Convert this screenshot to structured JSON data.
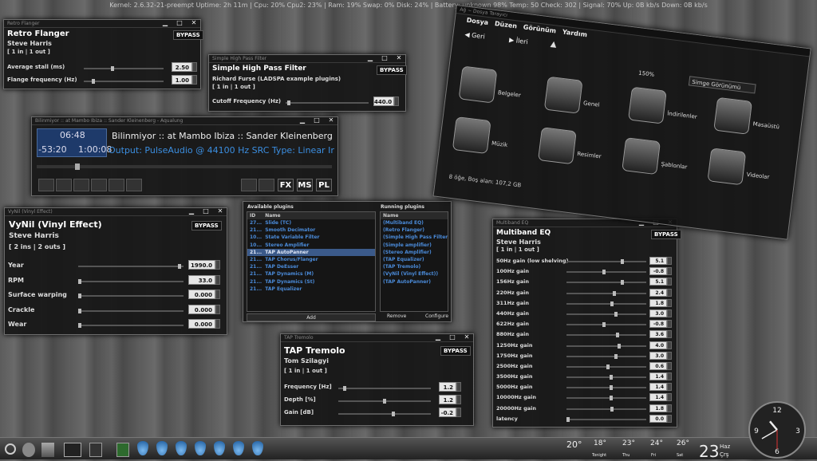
{
  "topbar": {
    "text": "Kernel: 2.6.32-21-preempt  Uptime: 2h 11m  |  Cpu: 20%  Cpu2: 23%  |  Ram: 19%  Swap: 0%  Disk: 24%  |  Battery: unknown  98%  Temp: 50  Check: 302  |  Signal: 70%  Up: 0B kb/s  Down: 0B kb/s"
  },
  "flanger": {
    "wintitle": "Retro Flanger",
    "title": "Retro Flanger",
    "author": "Steve Harris",
    "io": "[ 1 in | 1 out ]",
    "bypass": "BYPASS",
    "params": [
      {
        "label": "Average stall (ms)",
        "value": "2.50",
        "level": 0.35
      },
      {
        "label": "Flange frequency (Hz)",
        "value": "1.00",
        "level": 0.1
      }
    ]
  },
  "hpf": {
    "wintitle": "Simple High Pass Filter",
    "title": "Simple High Pass Filter",
    "author": "Richard Furse (LADSPA example plugins)",
    "io": "[ 1 in | 1 out ]",
    "bypass": "BYPASS",
    "params": [
      {
        "label": "Cutoff Frequency (Hz)",
        "value": "440.0",
        "level": 0.02
      }
    ]
  },
  "player": {
    "wintitle": "Bilinmiyor :: at Mambo Ibiza :: Sander Kleinenberg - Aqualung",
    "time1": "06:48",
    "time2": "-53:20",
    "time3": "1:00:08",
    "track": "Bilinmiyor :: at Mambo Ibiza :: Sander Kleinenberg",
    "output": "Output: PulseAudio @ 44100 Hz SRC Type: Linear Ir",
    "fx": "FX",
    "ms": "MS",
    "pl": "PL"
  },
  "vynil": {
    "wintitle": "VyNil (Vinyl Effect)",
    "title": "VyNil (Vinyl Effect)",
    "author": "Steve Harris",
    "io": "[ 2 ins | 2 outs ]",
    "bypass": "BYPASS",
    "params": [
      {
        "label": "Year",
        "value": "1990.0",
        "level": 0.98
      },
      {
        "label": "RPM",
        "value": "33.0",
        "level": 0.0
      },
      {
        "label": "Surface warping",
        "value": "0.000",
        "level": 0.0
      },
      {
        "label": "Crackle",
        "value": "0.000",
        "level": 0.0
      },
      {
        "label": "Wear",
        "value": "0.000",
        "level": 0.0
      }
    ]
  },
  "plugins": {
    "available_title": "Available plugins",
    "running_title": "Running plugins",
    "col_id": "ID",
    "col_name": "Name",
    "col_rname": "Name",
    "available": [
      {
        "id": "27...",
        "name": "Slide (TC)"
      },
      {
        "id": "21...",
        "name": "Smooth Decimator"
      },
      {
        "id": "10...",
        "name": "State Variable Filter"
      },
      {
        "id": "10...",
        "name": "Stereo Amplifier"
      },
      {
        "id": "21...",
        "name": "TAP AutoPanner"
      },
      {
        "id": "21...",
        "name": "TAP Chorus/Flanger"
      },
      {
        "id": "21...",
        "name": "TAP DeEsser"
      },
      {
        "id": "21...",
        "name": "TAP Dynamics (M)"
      },
      {
        "id": "21...",
        "name": "TAP Dynamics (St)"
      },
      {
        "id": "21...",
        "name": "TAP Equalizer"
      }
    ],
    "running": [
      "(Multiband EQ)",
      "(Retro Flanger)",
      "(Simple High Pass Filter)",
      "(Simple amplifier)",
      "(Stereo Amplifier)",
      "(TAP Equalizer)",
      "(TAP Tremolo)",
      "(VyNil (Vinyl Effect))",
      "(TAP AutoPanner)"
    ],
    "add": "Add",
    "remove": "Remove",
    "configure": "Configure"
  },
  "tremolo": {
    "wintitle": "TAP Tremolo",
    "title": "TAP Tremolo",
    "author": "Tom Szilagyi",
    "io": "[ 1 in | 1 out ]",
    "bypass": "BYPASS",
    "params": [
      {
        "label": "Frequency [Hz]",
        "value": "1.2",
        "level": 0.05
      },
      {
        "label": "Depth [%]",
        "value": "1.2",
        "level": 0.5
      },
      {
        "label": "Gain [dB]",
        "value": "-0.2",
        "level": 0.6
      }
    ]
  },
  "eq": {
    "wintitle": "Multiband EQ",
    "title": "Multiband EQ",
    "author": "Steve Harris",
    "io": "[ 1 in | 1 out ]",
    "bypass": "BYPASS",
    "params": [
      {
        "label": "50Hz gain (low shelving)",
        "value": "5.1"
      },
      {
        "label": "100Hz gain",
        "value": "-0.8"
      },
      {
        "label": "156Hz gain",
        "value": "5.1"
      },
      {
        "label": "220Hz gain",
        "value": "2.4"
      },
      {
        "label": "311Hz gain",
        "value": "1.8"
      },
      {
        "label": "440Hz gain",
        "value": "3.0"
      },
      {
        "label": "622Hz gain",
        "value": "-0.8"
      },
      {
        "label": "880Hz gain",
        "value": "3.6"
      },
      {
        "label": "1250Hz gain",
        "value": "4.0"
      },
      {
        "label": "1750Hz gain",
        "value": "3.0"
      },
      {
        "label": "2500Hz gain",
        "value": "0.6"
      },
      {
        "label": "3500Hz gain",
        "value": "1.4"
      },
      {
        "label": "5000Hz gain",
        "value": "1.4"
      },
      {
        "label": "10000Hz gain",
        "value": "1.4"
      },
      {
        "label": "20000Hz gain",
        "value": "1.8"
      },
      {
        "label": "latency",
        "value": "0.0"
      }
    ]
  },
  "filemanager": {
    "wintitle": "Ağ ~ Dosya Tarayıcı",
    "menu": [
      "Dosya",
      "Düzen",
      "Görünüm",
      "Yardım"
    ],
    "back": "Geri",
    "forward": "İleri",
    "zoom": "150%",
    "view": "Simge Görünümü",
    "status": "8 öğe, Boş alan: 107,2 GB",
    "items": [
      "Belgeler",
      "Genel",
      "İndirilenler",
      "Masaüstü",
      "Müzik",
      "Resimler",
      "Şablonlar",
      "Videolar"
    ]
  },
  "weather": {
    "temps": [
      "20°",
      "18°",
      "23°",
      "24°",
      "26°"
    ],
    "days": [
      "",
      "Tonight",
      "Thu",
      "Fri",
      "Sat"
    ],
    "now": "23",
    "unit": "Haz",
    "day": "Çrş"
  },
  "clock": {
    "hour": 10,
    "minute": 40,
    "second": 30
  }
}
